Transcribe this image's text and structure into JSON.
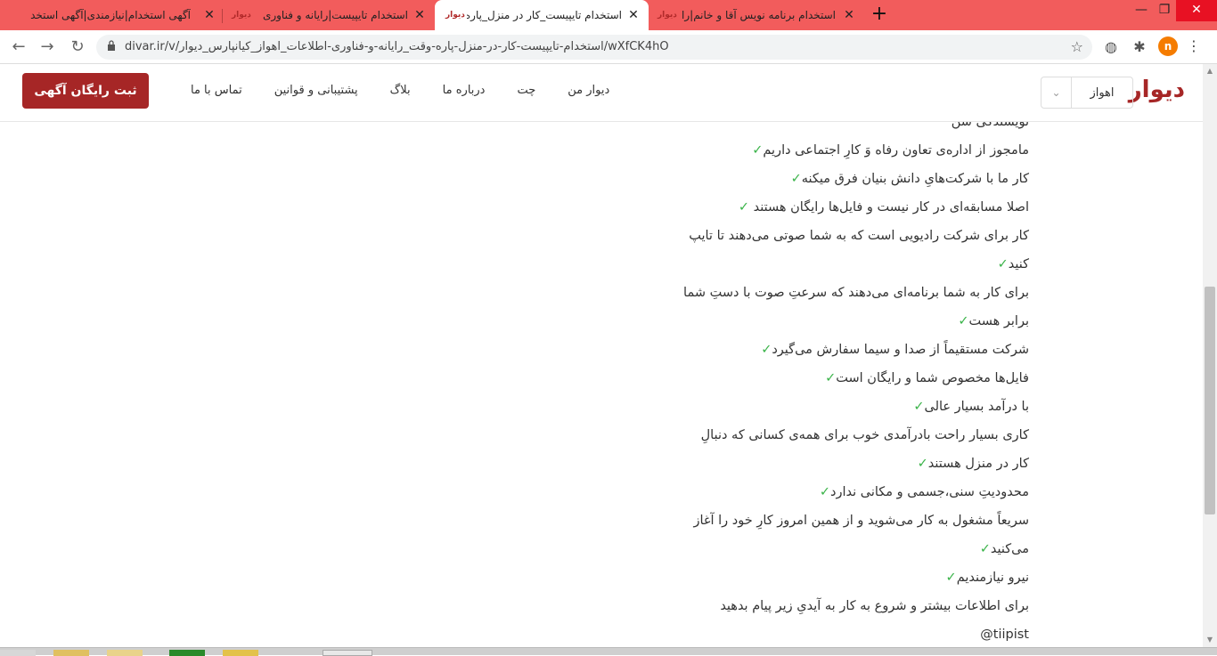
{
  "tabs": [
    {
      "title": "آگهی استخدام|نیازمندی|آگهی استخد",
      "favicon": "دیوار",
      "active": false
    },
    {
      "title": "استخدام تایپیست|رایانه و فناوری اطلا",
      "favicon": "دیوار",
      "active": false
    },
    {
      "title": "استخدام تایپیست_کار در منزل_پاره و",
      "favicon": "دیوار",
      "active": true
    },
    {
      "title": "استخدام برنامه نویس آقا و خانم|رایانه",
      "favicon": "دیوار",
      "active": false
    }
  ],
  "toolbar": {
    "url": "divar.ir/v/استخدام-تایپیست-کار-در-منزل-پاره-وقت_رایانه-و-فناوری-اطلاعات_اهواز_کیانپارس_دیوار/wXfCK4hO",
    "profile_initial": "n",
    "icons": [
      "back-icon",
      "forward-icon",
      "reload-icon",
      "lock-icon",
      "star-icon",
      "globe-icon",
      "puzzle-icon",
      "kebab-icon"
    ]
  },
  "header": {
    "logo": "دیوار",
    "city": "اهواز",
    "nav": [
      "دیوار من",
      "چت",
      "درباره ما",
      "بلاگ",
      "پشتیبانی و قوانین",
      "تماس با ما"
    ],
    "cta": "ثبت رایگان آگهی"
  },
  "content": {
    "lines": [
      {
        "text": "نویسندگی شن",
        "check": ""
      },
      {
        "text": "مامجوز از اداره‌ی تعاون رفاه وَ کارِ اجتماعی داریم",
        "check": "✓"
      },
      {
        "text": "کار ما با شرکت‌هایِ دانش بنیان فرق میکنه",
        "check": "✓"
      },
      {
        "text": "اصلا مسابقه‌ای در کار نیست و فایل‌ها رایگان هستند ",
        "check": "✓"
      },
      {
        "text": "کار برای شرکت رادیویی است که به شما صوتی می‌دهند تا تایپ",
        "check": ""
      },
      {
        "text": "کنید",
        "check": "✓"
      },
      {
        "text": "برای کار به شما برنامه‌ای می‌دهند که سرعتِ صوت با دستِ شما",
        "check": ""
      },
      {
        "text": "برابر هست",
        "check": "✓"
      },
      {
        "text": "شرکت مستقیماً از صدا و سیما سفارش می‌گیرد",
        "check": "✓"
      },
      {
        "text": "فایل‌ها مخصوص شما و رایگان است",
        "check": "✓"
      },
      {
        "text": "با درآمد بسیار عالی",
        "check": "✓"
      },
      {
        "text": "کاری بسیار راحت بادرآمدی خوب برای همه‌ی کسانی که دنبالِ",
        "check": ""
      },
      {
        "text": "کار در منزل هستند",
        "check": "✓"
      },
      {
        "text": "محدودیتِ سنی،جسمی و مکانی ندارد",
        "check": "✓"
      },
      {
        "text": "سریعاً مشغول به کار می‌شوید و از همین امروز کارِ خود را آغاز",
        "check": ""
      },
      {
        "text": "می‌کنید",
        "check": "✓"
      },
      {
        "text": " نیرو نیازمندیم",
        "check": "✓"
      },
      {
        "text": "برای اطلاعات بیشتر و شروع به کار به آیدیِ زیر پیام بدهید",
        "check": ""
      },
      {
        "text": "tiipist@",
        "check": ""
      }
    ]
  },
  "colors": {
    "tabstrip": "#f25c5c",
    "brand": "#a62626",
    "check": "#3bb44a"
  }
}
